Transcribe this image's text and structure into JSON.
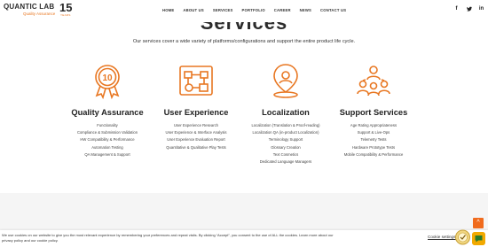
{
  "brand": {
    "name": "QUANTIC LAB",
    "anniversary": "15",
    "years_label": "YEARS",
    "tagline": "Quality Assurance",
    "accent": "#e87722"
  },
  "nav": {
    "items": [
      "HOME",
      "ABOUT US",
      "SERVICES",
      "PORTFOLIO",
      "CAREER",
      "NEWS",
      "CONTACT US"
    ]
  },
  "social": {
    "facebook": "f",
    "twitter": "t",
    "linkedin": "in"
  },
  "section": {
    "title": "Services",
    "intro": "Our services cover a wide variety of platforms/configurations and support the entire product life cycle."
  },
  "columns": [
    {
      "icon": "award-10-icon",
      "title": "Quality Assurance",
      "items": [
        "Functionality",
        "Compliance & Submission Validation",
        "HW Compatibility & Performance",
        "Automation Testing",
        "QA Management & Support"
      ]
    },
    {
      "icon": "workflow-diagram-icon",
      "title": "User Experience",
      "items": [
        "User Experience Research",
        "User Experience & Interface Analysis",
        "User Experience Evaluation Report",
        "Quantitative & Qualitative Play Tests"
      ]
    },
    {
      "icon": "location-pin-icon",
      "title": "Localization",
      "items": [
        "Localization (Translation & Proof-reading)",
        "Localization QA (in-product Localization)",
        "Terminology Support",
        "Glossary Creation",
        "Text Cosmetics",
        "Dedicated Language Managers"
      ]
    },
    {
      "icon": "support-team-icon",
      "title": "Support Services",
      "items": [
        "Age Rating Appropriateness",
        "Support & Live-Ops",
        "Telemetry Tests",
        "Hardware Prototype Tests",
        "Mobile Compatibility & Performance"
      ]
    }
  ],
  "cookie": {
    "text": "We use cookies on our website to give you the most relevant experience by remembering your preferences and repeat visits. By clicking “Accept”, you consent to the use of ALL the cookies. Learn more about our privacy policy and our cookie policy.",
    "settings_label": "Cookie settings"
  },
  "scroll_top": "^"
}
